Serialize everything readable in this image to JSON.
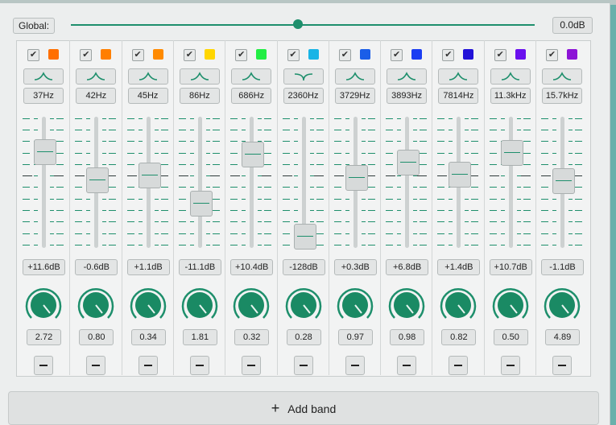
{
  "global": {
    "label": "Global:",
    "value": "0.0dB",
    "slider_fraction": 0.49
  },
  "add_band": {
    "label": "Add band",
    "icon": "plus-icon"
  },
  "gain_range_db": [
    -128,
    12
  ],
  "bands": [
    {
      "color": "#ff6f00",
      "filter": "bell",
      "freq": "37Hz",
      "gain": "+11.6dB",
      "q": "2.72",
      "level": 0.79,
      "enabled": true
    },
    {
      "color": "#ff7f00",
      "filter": "bell",
      "freq": "42Hz",
      "gain": "-0.6dB",
      "q": "0.80",
      "level": 0.53,
      "enabled": true
    },
    {
      "color": "#ff8a00",
      "filter": "bell",
      "freq": "45Hz",
      "gain": "+1.1dB",
      "q": "0.34",
      "level": 0.57,
      "enabled": true
    },
    {
      "color": "#ffd600",
      "filter": "bell",
      "freq": "86Hz",
      "gain": "-11.1dB",
      "q": "1.81",
      "level": 0.31,
      "enabled": true
    },
    {
      "color": "#22ee44",
      "filter": "bell",
      "freq": "686Hz",
      "gain": "+10.4dB",
      "q": "0.32",
      "level": 0.77,
      "enabled": true
    },
    {
      "color": "#18b4e6",
      "filter": "notch",
      "freq": "2360Hz",
      "gain": "-128dB",
      "q": "0.28",
      "level": 0.0,
      "enabled": true
    },
    {
      "color": "#1a5ee8",
      "filter": "bell",
      "freq": "3729Hz",
      "gain": "+0.3dB",
      "q": "0.97",
      "level": 0.55,
      "enabled": true
    },
    {
      "color": "#1b3ef2",
      "filter": "bell",
      "freq": "3893Hz",
      "gain": "+6.8dB",
      "q": "0.98",
      "level": 0.69,
      "enabled": true
    },
    {
      "color": "#2212d8",
      "filter": "bell",
      "freq": "7814Hz",
      "gain": "+1.4dB",
      "q": "0.82",
      "level": 0.58,
      "enabled": true
    },
    {
      "color": "#6a10ee",
      "filter": "bell",
      "freq": "11.3kHz",
      "gain": "+10.7dB",
      "q": "0.50",
      "level": 0.78,
      "enabled": true
    },
    {
      "color": "#8c14d6",
      "filter": "bell",
      "freq": "15.7kHz",
      "gain": "-1.1dB",
      "q": "4.89",
      "level": 0.52,
      "enabled": true
    }
  ]
}
